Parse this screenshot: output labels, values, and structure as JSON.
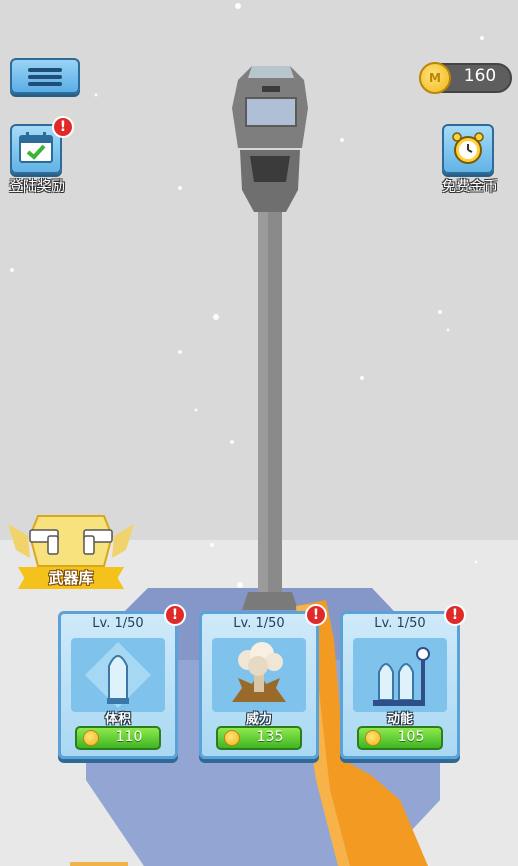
{
  "hud": {
    "coins": "160",
    "coin_icon": "coin-icon",
    "menu_icon": "hamburger-menu-icon"
  },
  "side_buttons": {
    "login_reward": {
      "label": "登陆奖励",
      "icon": "calendar-check-icon",
      "badge": "!"
    },
    "free_coins": {
      "label": "免费金币",
      "icon": "alarm-clock-icon"
    }
  },
  "armory": {
    "label": "武器库",
    "icon": "pistols-icon"
  },
  "upgrades": [
    {
      "level": "Lv. 1/50",
      "name": "体积",
      "cost": "110",
      "badge": "!",
      "icon": "bullet-icon"
    },
    {
      "level": "Lv. 1/50",
      "name": "威力",
      "cost": "135",
      "badge": "!",
      "icon": "explosion-icon"
    },
    {
      "level": "Lv. 1/50",
      "name": "动能",
      "cost": "105",
      "badge": "!",
      "icon": "bullets-gauge-icon"
    }
  ],
  "scene": {
    "target": "parking-meter",
    "colors": {
      "sky": "#d9d9d9",
      "floor": "#e8e8e8",
      "platform": "#8c9fcf",
      "gun": "#f39a22"
    }
  }
}
